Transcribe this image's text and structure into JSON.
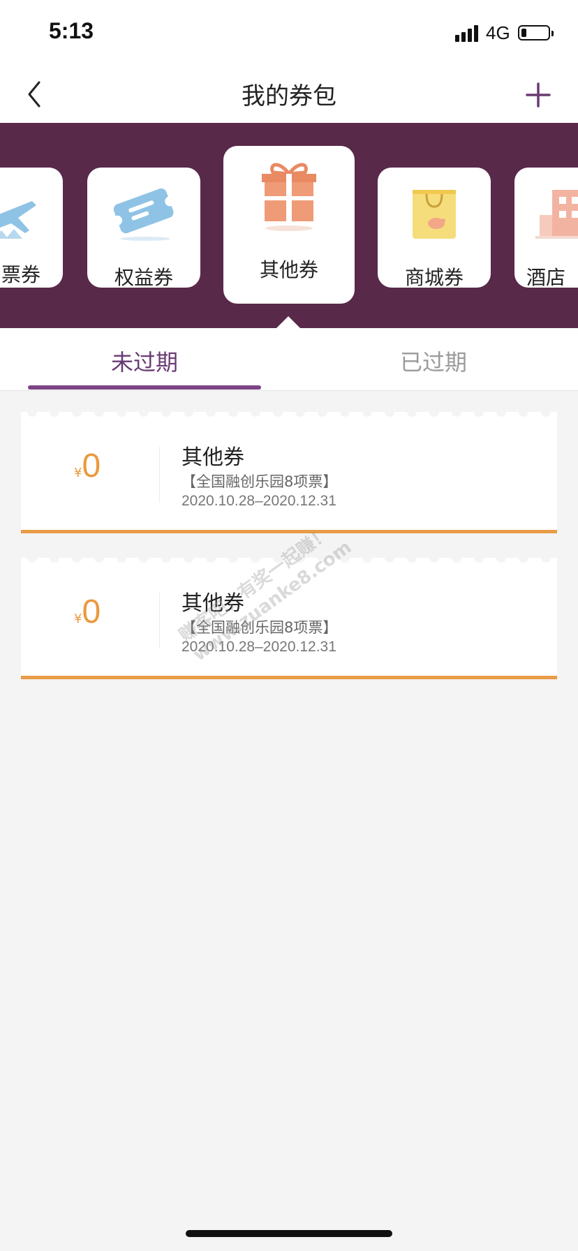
{
  "status_bar": {
    "time": "5:13",
    "network": "4G",
    "battery_level": 0.2
  },
  "nav": {
    "title": "我的券包",
    "back_icon": "chevron-left-icon",
    "add_icon": "plus-icon"
  },
  "categories": [
    {
      "label": "票券",
      "icon": "airplane-icon"
    },
    {
      "label": "权益券",
      "icon": "ticket-icon"
    },
    {
      "label": "其他券",
      "icon": "gift-icon",
      "selected": true
    },
    {
      "label": "商城券",
      "icon": "shopping-bag-icon"
    },
    {
      "label": "酒店",
      "icon": "hotel-icon"
    }
  ],
  "tabs": {
    "active": "未过期",
    "inactive": "已过期"
  },
  "coupons": [
    {
      "currency": "¥",
      "amount": "0",
      "name": "其他券",
      "desc": "【全国融创乐园8项票】",
      "date": "2020.10.28–2020.12.31"
    },
    {
      "currency": "¥",
      "amount": "0",
      "name": "其他券",
      "desc": "【全国融创乐园8项票】",
      "date": "2020.10.28–2020.12.31"
    }
  ],
  "watermark": {
    "line1": "赚客吧，有奖一起赚！",
    "line2": "www.zuanke8.com"
  },
  "colors": {
    "band": "#59294a",
    "accent": "#7b4585",
    "amount": "#ea9a3f"
  }
}
